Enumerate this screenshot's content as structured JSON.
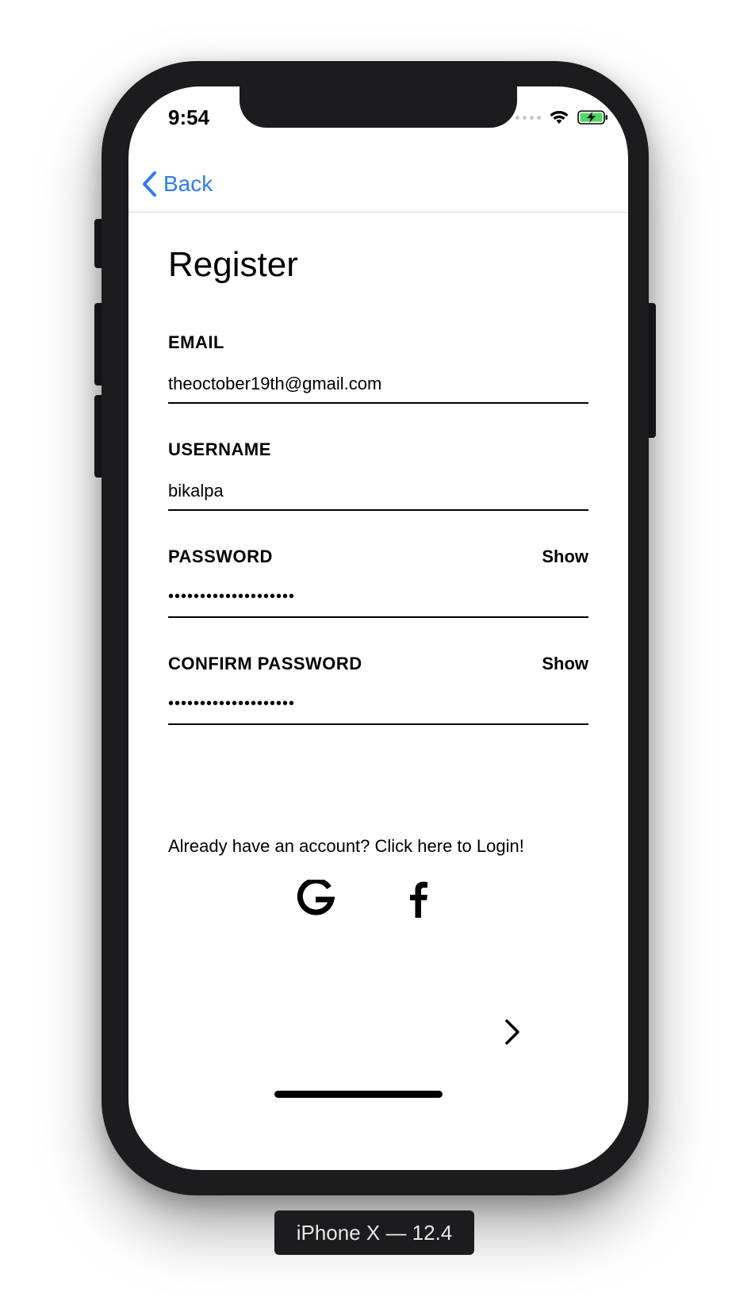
{
  "status_bar": {
    "time": "9:54"
  },
  "navbar": {
    "back_label": "Back"
  },
  "page": {
    "title": "Register"
  },
  "form": {
    "email": {
      "label": "EMAIL",
      "value": "theoctober19th@gmail.com"
    },
    "username": {
      "label": "USERNAME",
      "value": "bikalpa"
    },
    "password": {
      "label": "PASSWORD",
      "toggle": "Show",
      "value": "••••••••••••••••••••"
    },
    "confirm_password": {
      "label": "CONFIRM PASSWORD",
      "toggle": "Show",
      "value": "••••••••••••••••••••"
    }
  },
  "login_link": "Already have an account? Click here to Login!",
  "social": {
    "icons": [
      "google-icon",
      "facebook-icon"
    ]
  },
  "device_label": "iPhone X — 12.4",
  "colors": {
    "accent": "#2f7df0",
    "battery": "#4cd964",
    "frame": "#1c1c1e"
  }
}
